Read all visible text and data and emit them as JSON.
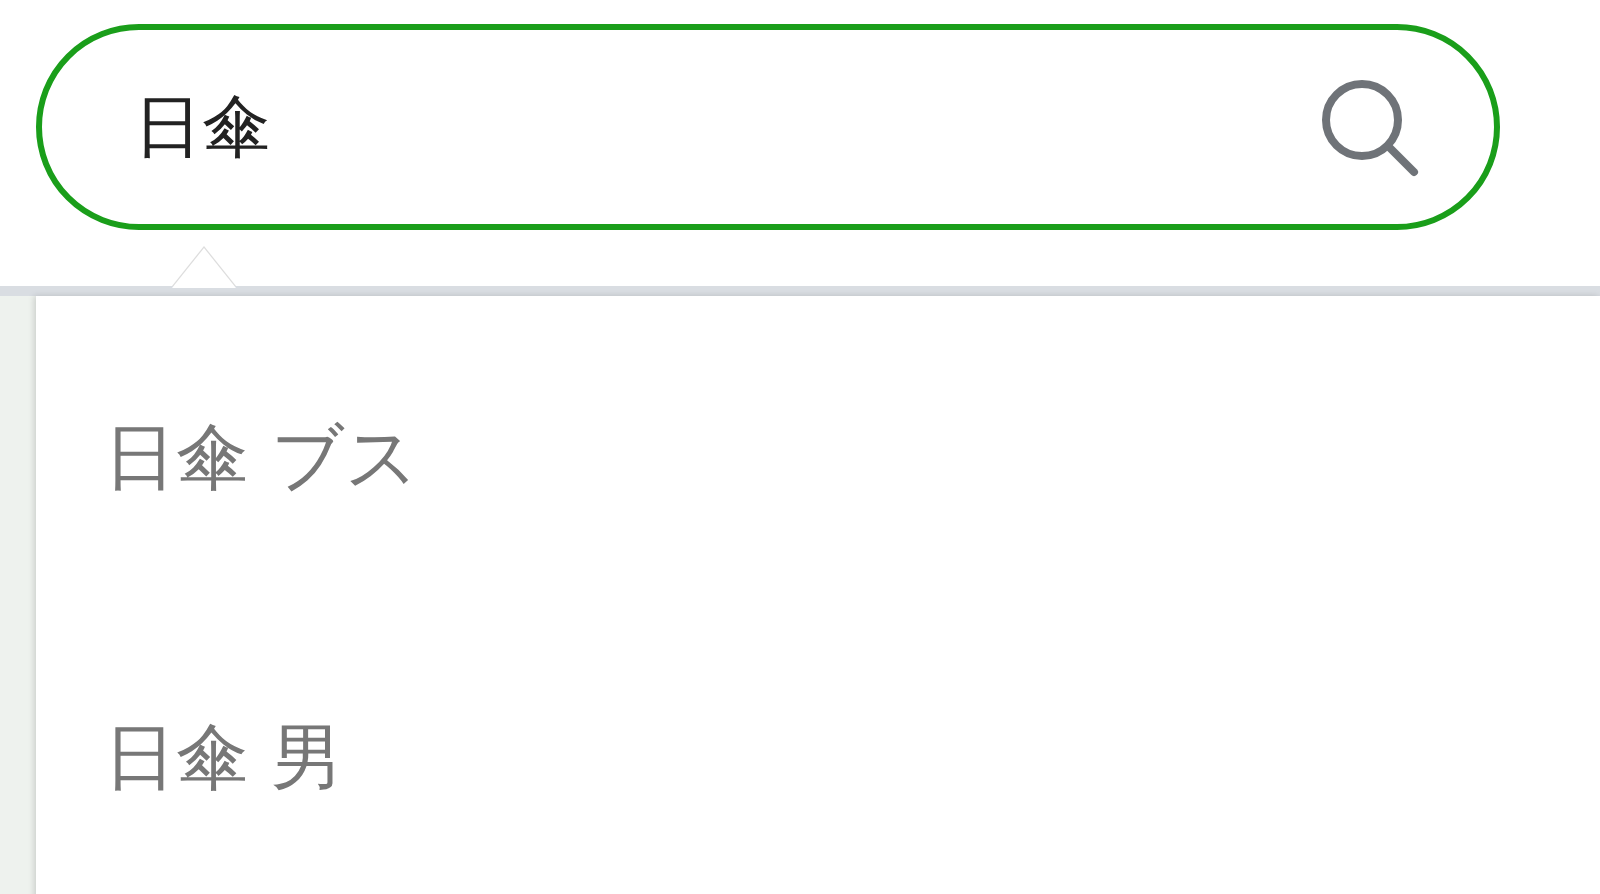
{
  "search": {
    "value": "日傘"
  },
  "suggestions": [
    {
      "text": "日傘 ブス"
    },
    {
      "text": "日傘 男"
    }
  ]
}
